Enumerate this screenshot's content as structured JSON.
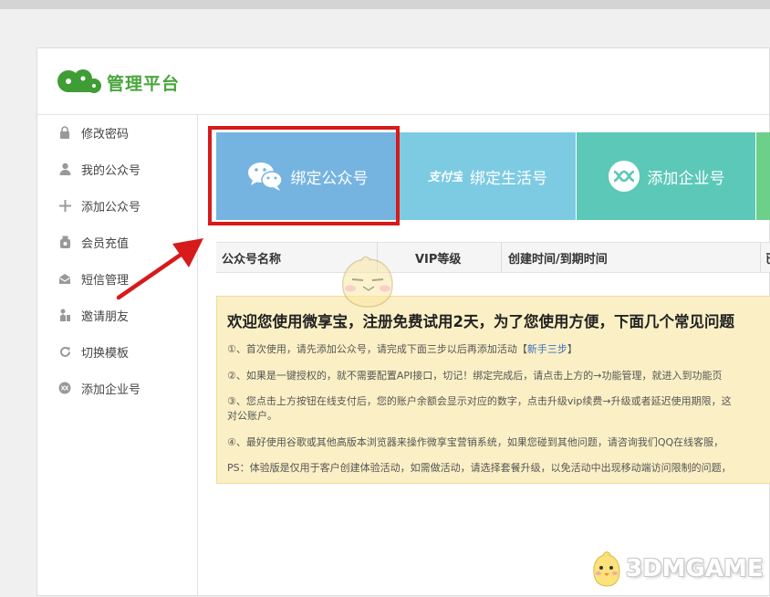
{
  "brand": {
    "title": "管理平台",
    "logo_icon": "gear-cloud-logo",
    "accent_color": "#4aa53c"
  },
  "sidebar": {
    "items": [
      {
        "label": "修改密码",
        "icon": "lock-icon"
      },
      {
        "label": "我的公众号",
        "icon": "user-icon"
      },
      {
        "label": "添加公众号",
        "icon": "plus-icon"
      },
      {
        "label": "会员充值",
        "icon": "bag-icon"
      },
      {
        "label": "短信管理",
        "icon": "envelope-icon"
      },
      {
        "label": "邀请朋友",
        "icon": "invite-icon"
      },
      {
        "label": "切换模板",
        "icon": "refresh-icon"
      },
      {
        "label": "添加企业号",
        "icon": "enterprise-icon"
      }
    ]
  },
  "tiles": [
    {
      "label": "绑定公众号",
      "icon": "wechat-icon",
      "color": "#75b4e0"
    },
    {
      "label": "绑定生活号",
      "icon": "alipay-icon",
      "color": "#7ccbe3"
    },
    {
      "label": "添加企业号",
      "icon": "enterprise-icon",
      "color": "#5cc8b8"
    }
  ],
  "table": {
    "columns": [
      "公众号名称",
      "VIP等级",
      "创建时间/到期时间",
      "已"
    ]
  },
  "notice": {
    "title": "欢迎您使用微享宝，注册免费试用2天，为了您使用方便，下面几个常见问题",
    "lines": [
      {
        "text": "①、首次使用，请先添加公众号，请完成下面三步以后再添加活动【",
        "link": "新手三步",
        "suffix": "】"
      },
      {
        "text": "②、如果是一键授权的，就不需要配置API接口，切记！绑定完成后，请点击上方的→功能管理，就进入到功能页"
      },
      {
        "text": "③、您点击上方按钮在线支付后，您的账户余额会显示对应的数字，点击升级vip续费→升级或者延迟使用期限，这"
      },
      {
        "text": "对公账户。"
      },
      {
        "text": "④、最好使用谷歌或其他高版本浏览器来操作微享宝营销系统，如果您碰到其他问题，请咨询我们QQ在线客服，"
      },
      {
        "text": "PS：体验版是仅用于客户创建体验活动，如需做活动，请选择套餐升级，以免活动中出现移动端访问限制的问题，"
      }
    ]
  },
  "watermark": {
    "text": "3DMGAME"
  }
}
